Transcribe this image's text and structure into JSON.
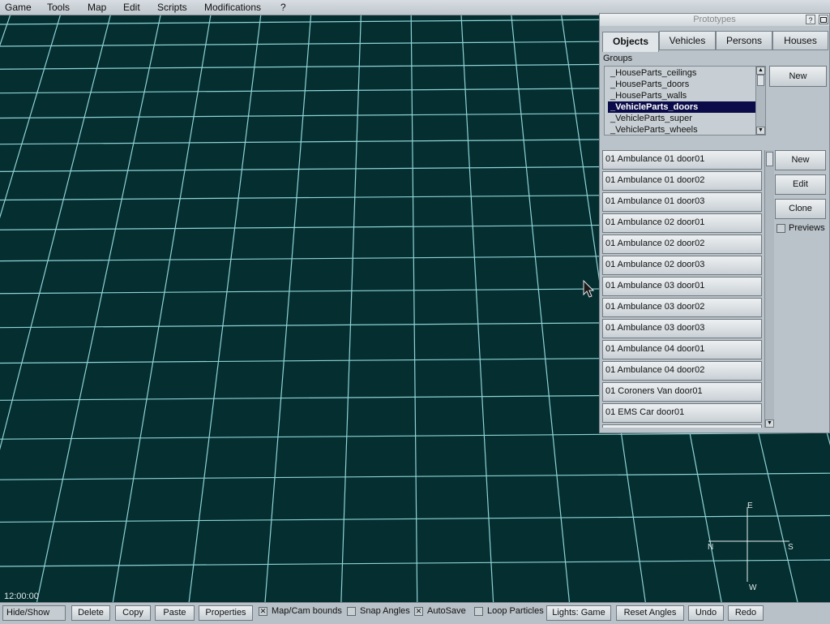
{
  "menu": [
    "Game",
    "Tools",
    "Map",
    "Edit",
    "Scripts",
    "Modifications",
    "?"
  ],
  "prototypes": {
    "title": "Prototypes",
    "help_glyph": "?",
    "tabs": [
      "Objects",
      "Vehicles",
      "Persons",
      "Houses"
    ],
    "active_tab": "Objects",
    "groups_label": "Groups",
    "groups": [
      "_HouseParts_ceilings",
      "_HouseParts_doors",
      "_HouseParts_walls",
      "_VehicleParts_doors",
      "_VehicleParts_super",
      "_VehicleParts_wheels"
    ],
    "selected_group": "_VehicleParts_doors",
    "groups_new_label": "New",
    "items": [
      "01 Ambulance 01 door01",
      "01 Ambulance 01 door02",
      "01 Ambulance 01 door03",
      "01 Ambulance 02 door01",
      "01 Ambulance 02 door02",
      "01 Ambulance 02 door03",
      "01 Ambulance 03 door01",
      "01 Ambulance 03 door02",
      "01 Ambulance 03 door03",
      "01 Ambulance 04 door01",
      "01 Ambulance 04 door02",
      "01 Coroners Van door01",
      "01 EMS Car door01"
    ],
    "actions": {
      "new": "New",
      "edit": "Edit",
      "clone": "Clone",
      "previews": "Previews"
    },
    "previews_checked": false
  },
  "compass": {
    "north": "N",
    "east": "E",
    "south": "S",
    "west": "W"
  },
  "clock": "12:00:00",
  "toolbar": {
    "hide_show": "Hide/Show",
    "delete": "Delete",
    "copy": "Copy",
    "paste": "Paste",
    "properties": "Properties",
    "map_cam_bounds": "Map/Cam bounds",
    "map_cam_bounds_checked": true,
    "snap_angles": "Snap Angles",
    "snap_angles_checked": false,
    "autosave": "AutoSave",
    "autosave_checked": true,
    "loop_particles": "Loop Particles",
    "loop_particles_checked": false,
    "lights": "Lights: Game",
    "reset_angles": "Reset Angles",
    "undo": "Undo",
    "redo": "Redo"
  },
  "colors": {
    "background": "#052e30",
    "grid": "#8fd3d6",
    "selection": "#0b0b4a"
  }
}
